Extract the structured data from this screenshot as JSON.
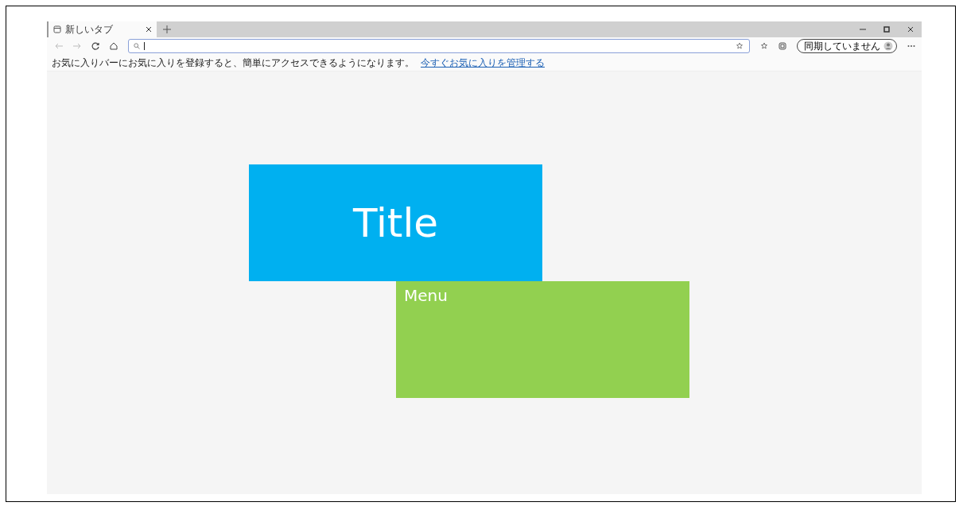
{
  "tabs": [
    {
      "title": "新しいタブ",
      "selected": true
    }
  ],
  "profile": {
    "label": "同期していません"
  },
  "favorites_bar": {
    "message": "お気に入りバーにお気に入りを登録すると、簡単にアクセスできるようになります。",
    "link": "今すぐお気に入りを管理する"
  },
  "content": {
    "title_box": {
      "text": "Title"
    },
    "menu_box": {
      "text": "Menu"
    }
  }
}
